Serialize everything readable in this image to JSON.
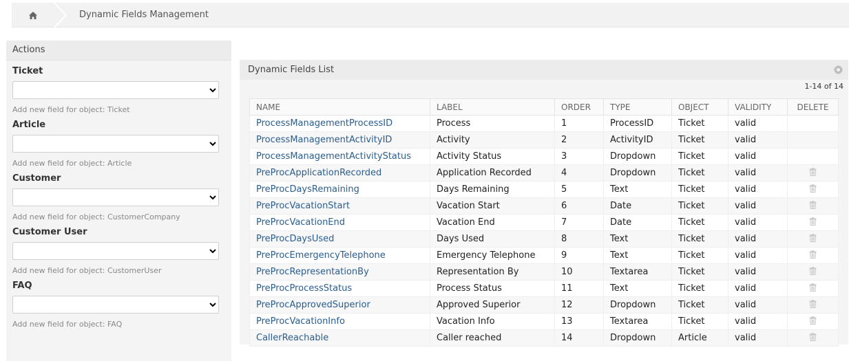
{
  "breadcrumb": {
    "home_icon": "home-icon",
    "title": "Dynamic Fields Management"
  },
  "sidebar": {
    "title": "Actions",
    "objects": [
      {
        "title": "Ticket",
        "hint": "Add new field for object: Ticket"
      },
      {
        "title": "Article",
        "hint": "Add new field for object: Article"
      },
      {
        "title": "Customer",
        "hint": "Add new field for object: CustomerCompany"
      },
      {
        "title": "Customer User",
        "hint": "Add new field for object: CustomerUser"
      },
      {
        "title": "FAQ",
        "hint": "Add new field for object: FAQ"
      }
    ]
  },
  "main": {
    "title": "Dynamic Fields List",
    "settings_icon": "gear-icon",
    "pagination": "1-14 of 14",
    "columns": [
      "NAME",
      "LABEL",
      "ORDER",
      "TYPE",
      "OBJECT",
      "VALIDITY",
      "DELETE"
    ],
    "rows": [
      {
        "name": "ProcessManagementProcessID",
        "label": "Process",
        "order": "1",
        "type": "ProcessID",
        "object": "Ticket",
        "validity": "valid",
        "deletable": false
      },
      {
        "name": "ProcessManagementActivityID",
        "label": "Activity",
        "order": "2",
        "type": "ActivityID",
        "object": "Ticket",
        "validity": "valid",
        "deletable": false
      },
      {
        "name": "ProcessManagementActivityStatus",
        "label": "Activity Status",
        "order": "3",
        "type": "Dropdown",
        "object": "Ticket",
        "validity": "valid",
        "deletable": false
      },
      {
        "name": "PreProcApplicationRecorded",
        "label": "Application Recorded",
        "order": "4",
        "type": "Dropdown",
        "object": "Ticket",
        "validity": "valid",
        "deletable": true
      },
      {
        "name": "PreProcDaysRemaining",
        "label": "Days Remaining",
        "order": "5",
        "type": "Text",
        "object": "Ticket",
        "validity": "valid",
        "deletable": true
      },
      {
        "name": "PreProcVacationStart",
        "label": "Vacation Start",
        "order": "6",
        "type": "Date",
        "object": "Ticket",
        "validity": "valid",
        "deletable": true
      },
      {
        "name": "PreProcVacationEnd",
        "label": "Vacation End",
        "order": "7",
        "type": "Date",
        "object": "Ticket",
        "validity": "valid",
        "deletable": true
      },
      {
        "name": "PreProcDaysUsed",
        "label": "Days Used",
        "order": "8",
        "type": "Text",
        "object": "Ticket",
        "validity": "valid",
        "deletable": true
      },
      {
        "name": "PreProcEmergencyTelephone",
        "label": "Emergency Telephone",
        "order": "9",
        "type": "Text",
        "object": "Ticket",
        "validity": "valid",
        "deletable": true
      },
      {
        "name": "PreProcRepresentationBy",
        "label": "Representation By",
        "order": "10",
        "type": "Textarea",
        "object": "Ticket",
        "validity": "valid",
        "deletable": true
      },
      {
        "name": "PreProcProcessStatus",
        "label": "Process Status",
        "order": "11",
        "type": "Text",
        "object": "Ticket",
        "validity": "valid",
        "deletable": true
      },
      {
        "name": "PreProcApprovedSuperior",
        "label": "Approved Superior",
        "order": "12",
        "type": "Dropdown",
        "object": "Ticket",
        "validity": "valid",
        "deletable": true
      },
      {
        "name": "PreProcVacationInfo",
        "label": "Vacation Info",
        "order": "13",
        "type": "Textarea",
        "object": "Ticket",
        "validity": "valid",
        "deletable": true
      },
      {
        "name": "CallerReachable",
        "label": "Caller reached",
        "order": "14",
        "type": "Dropdown",
        "object": "Article",
        "validity": "valid",
        "deletable": true
      }
    ]
  },
  "colors": {
    "link": "#2a5d8f",
    "panel": "#f4f4f4",
    "header": "#ececec"
  }
}
